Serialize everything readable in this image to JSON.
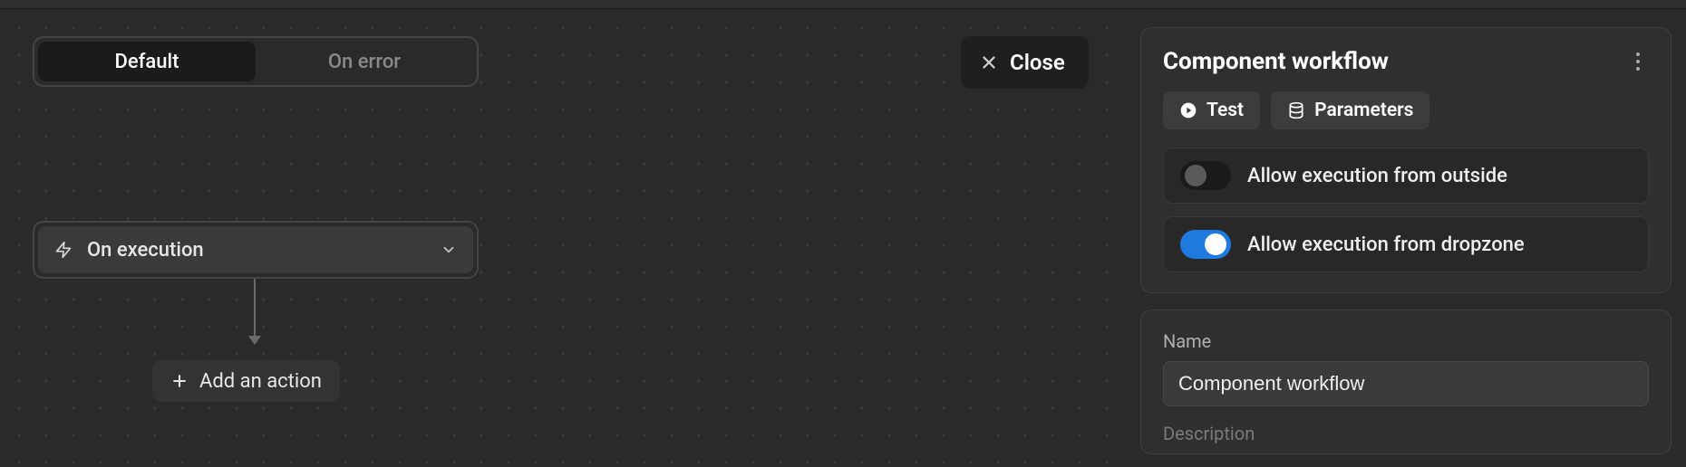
{
  "tabs": {
    "default": "Default",
    "on_error": "On error"
  },
  "trigger": {
    "label": "On execution"
  },
  "add_action_label": "Add an action",
  "close_label": "Close",
  "panel": {
    "title": "Component workflow",
    "test_label": "Test",
    "parameters_label": "Parameters",
    "toggle_outside": "Allow execution from outside",
    "toggle_dropzone": "Allow execution from dropzone",
    "name_label": "Name",
    "name_value": "Component workflow",
    "description_label": "Description"
  }
}
